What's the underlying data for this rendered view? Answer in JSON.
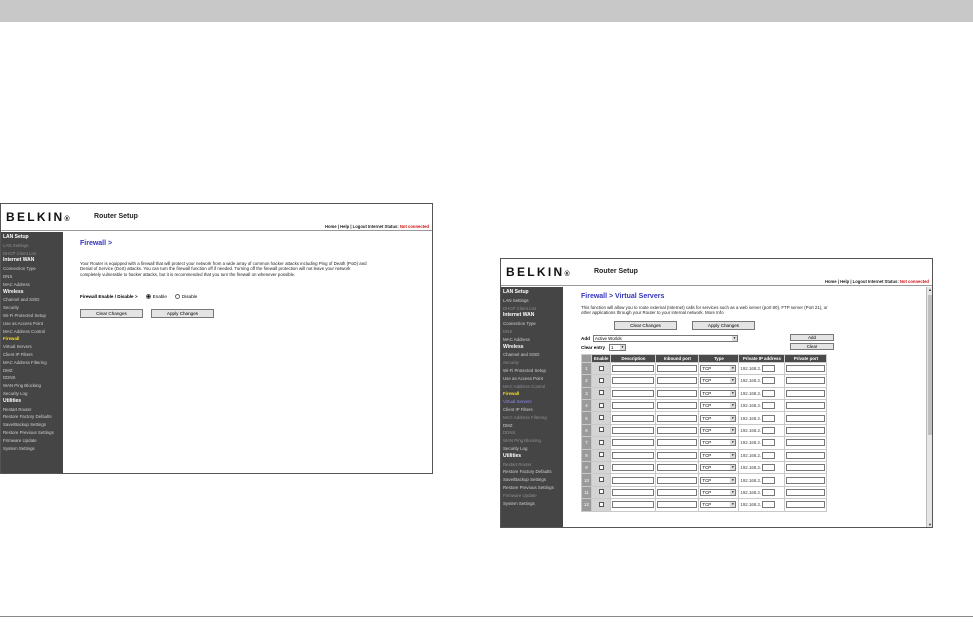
{
  "shot1": {
    "logo": "BELKIN",
    "title": "Router Setup",
    "top_links": "Home | Help | Logout   Internet Status:",
    "status": "Not connected",
    "sidebar": [
      {
        "label": "LAN Setup",
        "kind": "sec"
      },
      {
        "label": "LAN Settings",
        "kind": "dim"
      },
      {
        "label": "DHCP Client List",
        "kind": "dim"
      },
      {
        "label": "Internet WAN",
        "kind": "sec"
      },
      {
        "label": "Connection Type",
        "kind": "item"
      },
      {
        "label": "DNS",
        "kind": "item"
      },
      {
        "label": "MAC Address",
        "kind": "item"
      },
      {
        "label": "Wireless",
        "kind": "sec"
      },
      {
        "label": "Channel and SSID",
        "kind": "item"
      },
      {
        "label": "Security",
        "kind": "item"
      },
      {
        "label": "Wi-Fi Protected Setup",
        "kind": "item"
      },
      {
        "label": "Use as Access Point",
        "kind": "item"
      },
      {
        "label": "MAC Address Control",
        "kind": "item"
      },
      {
        "label": "Firewall",
        "kind": "cur"
      },
      {
        "label": "Virtual Servers",
        "kind": "item"
      },
      {
        "label": "Client IP Filters",
        "kind": "item"
      },
      {
        "label": "MAC Address Filtering",
        "kind": "item"
      },
      {
        "label": "DMZ",
        "kind": "item"
      },
      {
        "label": "DDNS",
        "kind": "item"
      },
      {
        "label": "WAN Ping Blocking",
        "kind": "item"
      },
      {
        "label": "Security Log",
        "kind": "item"
      },
      {
        "label": "Utilities",
        "kind": "sec"
      },
      {
        "label": "Restart Router",
        "kind": "item"
      },
      {
        "label": "Restore Factory Defaults",
        "kind": "item"
      },
      {
        "label": "Save/Backup Settings",
        "kind": "item"
      },
      {
        "label": "Restore Previous Settings",
        "kind": "item"
      },
      {
        "label": "Firmware Update",
        "kind": "item"
      },
      {
        "label": "System Settings",
        "kind": "item"
      }
    ],
    "page_title": "Firewall >",
    "description": "Your Router is equipped with a firewall that will protect your network from a wide array of common hacker attacks including Ping of Death (PoD) and Denial of Service (DoS) attacks. You can turn the firewall function off if needed. Turning off the firewall protection will not leave your network completely vulnerable to hacker attacks, but it is recommended that you turn the firewall on whenever possible.",
    "firewall_label": "Firewall Enable / Disable >",
    "enable_label": "Enable",
    "disable_label": "Disable",
    "clear_btn": "Clear Changes",
    "apply_btn": "Apply Changes"
  },
  "shot2": {
    "logo": "BELKIN",
    "title": "Router Setup",
    "top_links": "Home | Help | Logout   Internet Status:",
    "status": "Not connected",
    "sidebar": [
      {
        "label": "LAN Setup",
        "kind": "sec"
      },
      {
        "label": "LAN Settings",
        "kind": "item"
      },
      {
        "label": "DHCP Client List",
        "kind": "dim"
      },
      {
        "label": "Internet WAN",
        "kind": "sec"
      },
      {
        "label": "Connection Type",
        "kind": "item"
      },
      {
        "label": "DNS",
        "kind": "dim"
      },
      {
        "label": "MAC Address",
        "kind": "item"
      },
      {
        "label": "Wireless",
        "kind": "sec"
      },
      {
        "label": "Channel and SSID",
        "kind": "item"
      },
      {
        "label": "Security",
        "kind": "dim"
      },
      {
        "label": "Wi-Fi Protected Setup",
        "kind": "item"
      },
      {
        "label": "Use as Access Point",
        "kind": "item"
      },
      {
        "label": "MAC Address Control",
        "kind": "dim"
      },
      {
        "label": "Firewall",
        "kind": "cur"
      },
      {
        "label": "Virtual Servers",
        "kind": "link"
      },
      {
        "label": "Client IP Filters",
        "kind": "item"
      },
      {
        "label": "MAC Address Filtering",
        "kind": "dim"
      },
      {
        "label": "DMZ",
        "kind": "item"
      },
      {
        "label": "DDNS",
        "kind": "dim"
      },
      {
        "label": "WAN Ping Blocking",
        "kind": "dim"
      },
      {
        "label": "Security Log",
        "kind": "item"
      },
      {
        "label": "Utilities",
        "kind": "sec"
      },
      {
        "label": "Restart Router",
        "kind": "dim"
      },
      {
        "label": "Restore Factory Defaults",
        "kind": "item"
      },
      {
        "label": "Save/Backup Settings",
        "kind": "item"
      },
      {
        "label": "Restore Previous Settings",
        "kind": "item"
      },
      {
        "label": "Firmware Update",
        "kind": "dim"
      },
      {
        "label": "System Settings",
        "kind": "item"
      }
    ],
    "page_title": "Firewall > Virtual Servers",
    "description": "This function will allow you to route external (Internet) calls for services such as a web server (port 80), FTP server (Port 21), or other applications through your Router to your internal network. More Info",
    "clear_btn": "Clear Changes",
    "apply_btn": "Apply Changes",
    "add_label": "Add",
    "add_value": "Active Worlds",
    "clear_entry_label": "Clear entry",
    "clear_entry_value": "1",
    "add_btn": "Add",
    "clear_btn2": "Clear",
    "columns": [
      "Enable",
      "Description",
      "Inbound port",
      "Type",
      "Private IP address",
      "Private port"
    ],
    "rows": [
      {
        "num": "1",
        "type": "TCP",
        "ip": "192.168.2."
      },
      {
        "num": "2",
        "type": "TCP",
        "ip": "192.168.2."
      },
      {
        "num": "3",
        "type": "TCP",
        "ip": "192.168.2."
      },
      {
        "num": "4",
        "type": "TCP",
        "ip": "192.168.2."
      },
      {
        "num": "5",
        "type": "TCP",
        "ip": "192.168.2."
      },
      {
        "num": "6",
        "type": "TCP",
        "ip": "192.168.2."
      },
      {
        "num": "7",
        "type": "TCP",
        "ip": "192.168.2."
      },
      {
        "num": "8",
        "type": "TCP",
        "ip": "192.168.2."
      },
      {
        "num": "9",
        "type": "TCP",
        "ip": "192.168.2."
      },
      {
        "num": "10",
        "type": "TCP",
        "ip": "192.168.2."
      },
      {
        "num": "11",
        "type": "TCP",
        "ip": "192.168.2."
      },
      {
        "num": "12",
        "type": "TCP",
        "ip": "192.168.2."
      }
    ]
  }
}
